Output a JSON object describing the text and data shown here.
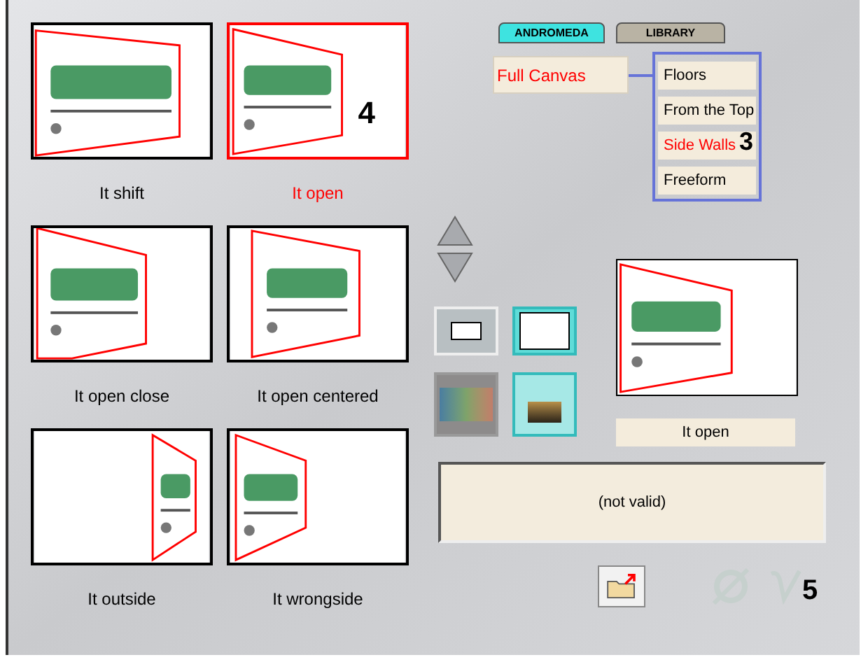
{
  "presets": [
    {
      "label": "It shift",
      "kind": "shift",
      "selected": false
    },
    {
      "label": "It open",
      "kind": "open",
      "selected": true
    },
    {
      "label": "It open close",
      "kind": "open_close",
      "selected": false
    },
    {
      "label": "It open centered",
      "kind": "open_centered",
      "selected": false
    },
    {
      "label": "It outside",
      "kind": "outside",
      "selected": false
    },
    {
      "label": "It wrongside",
      "kind": "wrongside",
      "selected": false
    }
  ],
  "presets_callout": "4",
  "tabs": [
    {
      "label": "ANDROMEDA",
      "selected": true
    },
    {
      "label": "LIBRARY",
      "selected": false
    }
  ],
  "mode_field": {
    "value": "Full Canvas"
  },
  "mode_menu": {
    "items": [
      {
        "label": "Floors",
        "selected": false
      },
      {
        "label": "From the Top",
        "selected": false
      },
      {
        "label": "Side Walls",
        "selected": true
      },
      {
        "label": "Freeform",
        "selected": false
      }
    ],
    "callout": "3"
  },
  "frame_buttons": [
    {
      "kind": "small",
      "selected": false
    },
    {
      "kind": "large",
      "selected": true
    }
  ],
  "image_buttons": [
    {
      "kind": "collage",
      "selected": false
    },
    {
      "kind": "perspective",
      "selected": true
    }
  ],
  "preview": {
    "kind": "open",
    "caption": "It open"
  },
  "status": "(not valid)",
  "version_logo": "5"
}
